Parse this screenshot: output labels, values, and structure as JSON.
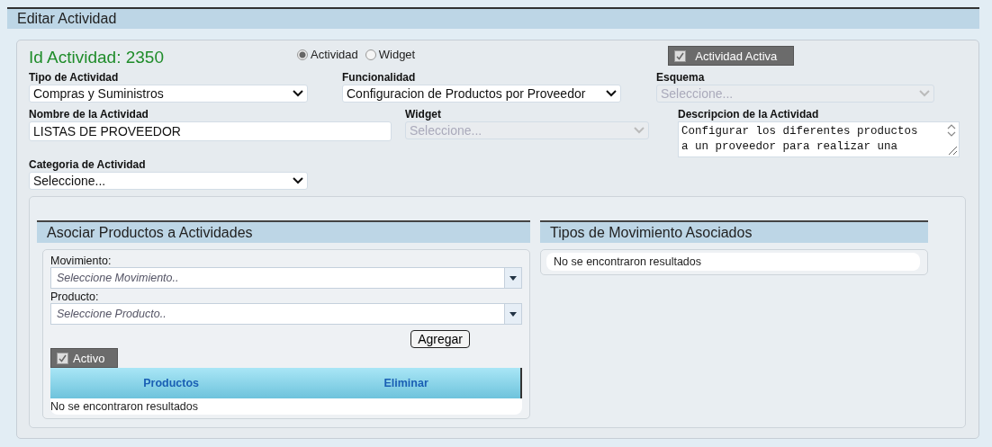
{
  "window": {
    "title": "Editar Actividad"
  },
  "form": {
    "id_label": "Id Actividad: 2350",
    "radios": [
      {
        "label": "Actividad",
        "selected": true
      },
      {
        "label": "Widget",
        "selected": false
      }
    ],
    "active_toggle": {
      "label": "Actividad Activa",
      "checked": true
    },
    "tipo": {
      "label": "Tipo de Actividad",
      "value": "Compras y Suministros",
      "disabled": false
    },
    "funcionalidad": {
      "label": "Funcionalidad",
      "value": "Configuracion de Productos por Proveedor",
      "disabled": false
    },
    "esquema": {
      "label": "Esquema",
      "value": "Seleccione...",
      "disabled": true
    },
    "nombre": {
      "label": "Nombre de la Actividad",
      "value": "LISTAS DE PROVEEDOR"
    },
    "widget": {
      "label": "Widget",
      "value": "Seleccione...",
      "disabled": true
    },
    "descripcion": {
      "label": "Descripcion de la Actividad",
      "value": "Configurar los diferentes productos a un proveedor para realizar una"
    },
    "categoria": {
      "label": "Categoria de Actividad",
      "value": "Seleccione...",
      "disabled": false
    }
  },
  "asociar": {
    "title": "Asociar Productos a Actividades",
    "movimiento": {
      "label": "Movimiento:",
      "placeholder": "Seleccione Movimiento.."
    },
    "producto": {
      "label": "Producto:",
      "placeholder": "Seleccione Producto.."
    },
    "add_button": "Agregar",
    "active_toggle": {
      "label": "Activo",
      "checked": true
    },
    "columns": [
      "Productos",
      "Eliminar"
    ],
    "empty": "No se encontraron resultados"
  },
  "tipos": {
    "title": "Tipos de Movimiento Asociados",
    "empty": "No se encontraron resultados"
  }
}
